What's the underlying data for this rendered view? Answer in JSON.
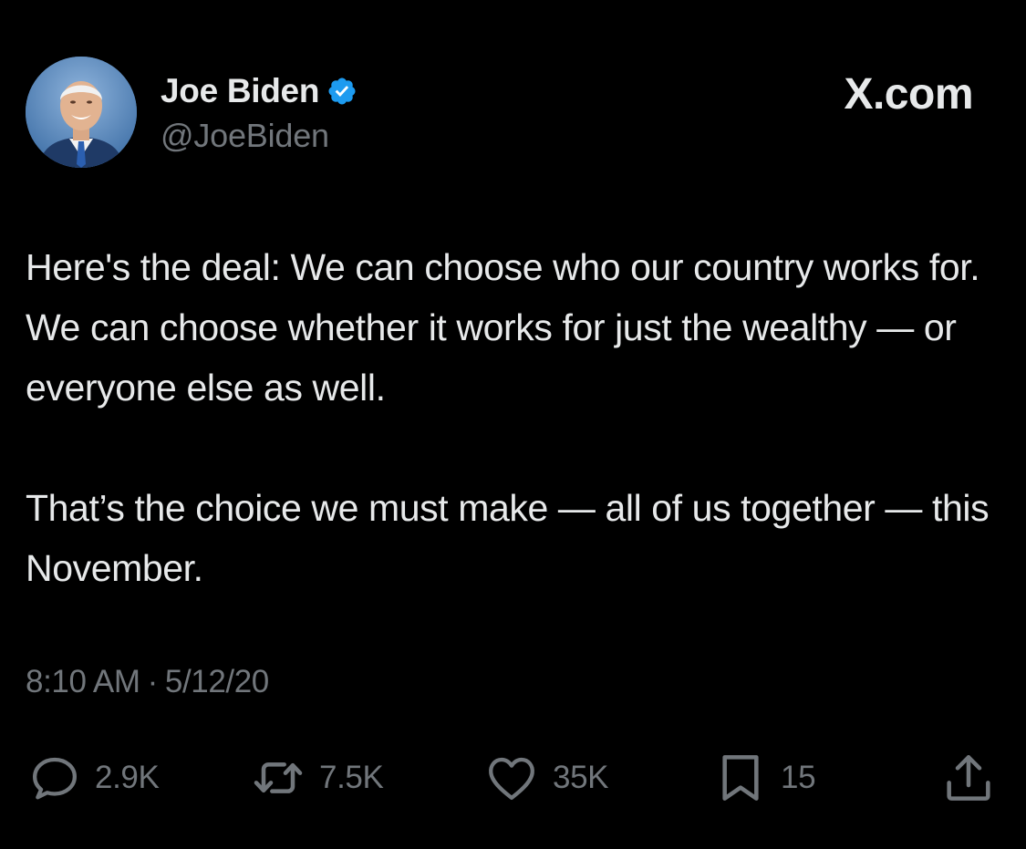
{
  "tweet": {
    "author": {
      "name": "Joe Biden",
      "handle": "@JoeBiden",
      "verified": true
    },
    "brand": "X.com",
    "paragraphs": [
      "Here's the deal: We can choose who our country works for. We can choose whether it works for just the wealthy — or everyone else as well.",
      "That’s the choice we must make — all of us together — this November."
    ],
    "time": "8:10 AM",
    "separator": "·",
    "date": "5/12/20",
    "actions": {
      "replies": "2.9K",
      "reposts": "7.5K",
      "likes": "35K",
      "bookmarks": "15"
    }
  },
  "colors": {
    "background": "#000000",
    "text": "#e7e9ea",
    "secondary": "#71767b",
    "verified": "#1d9bf0"
  },
  "icons": [
    "avatar",
    "verified-badge-icon",
    "reply-icon",
    "repost-icon",
    "like-icon",
    "bookmark-icon",
    "share-icon"
  ]
}
